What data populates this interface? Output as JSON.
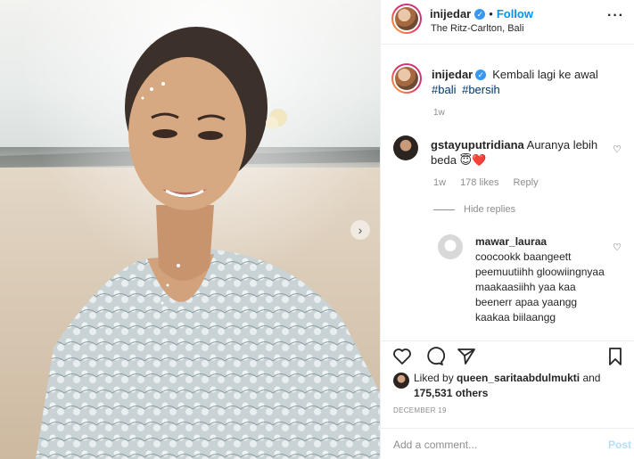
{
  "post": {
    "username": "inijedar",
    "follow_label": "Follow",
    "location": "The Ritz-Carlton, Bali",
    "more_icon": "more-horizontal-icon"
  },
  "caption": {
    "username": "inijedar",
    "text": "Kembali lagi ke awal",
    "hashtags": [
      "#bali",
      "#bersih"
    ],
    "time": "1w"
  },
  "comments": [
    {
      "username": "gstayuputridiana",
      "text": "Auranya lebih beda 😇❤️",
      "time": "1w",
      "likes": "178 likes",
      "reply_label": "Reply",
      "hide_replies_label": "Hide replies",
      "replies": [
        {
          "username": "mawar_lauraa",
          "text": "coocookk baangeett peemuutiihh gloowiingnyaa maakaasiihh yaa kaa beenerr apaa yaangg kaakaa biilaangg"
        }
      ]
    }
  ],
  "liked_by": {
    "prefix": "Liked by",
    "user": "queen_saritaabdulmukti",
    "and": "and",
    "count": "175,531 others"
  },
  "date": "DECEMBER 19",
  "add_comment": {
    "placeholder": "Add a comment...",
    "post_label": "Post"
  },
  "colors": {
    "link_blue": "#0095f6",
    "hashtag": "#00376b",
    "muted": "#8e8e8e",
    "heart_red": "#ed4956"
  }
}
